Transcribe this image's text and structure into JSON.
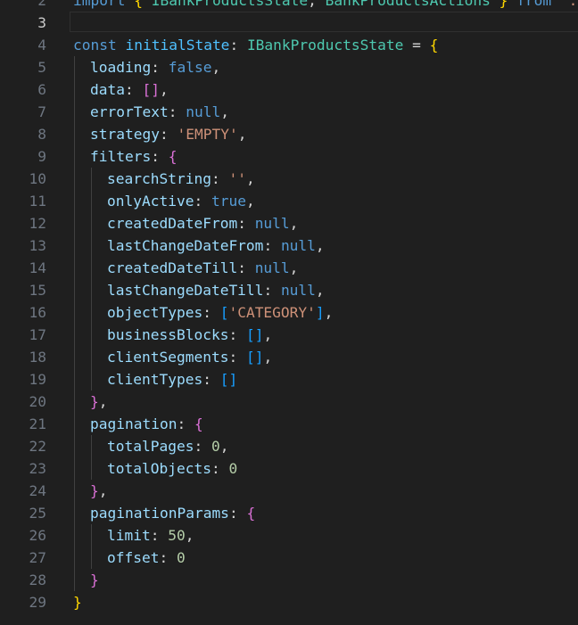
{
  "editor": {
    "language": "typescript",
    "colors": {
      "background": "#1f1f1f",
      "line_number": "#6e7681",
      "line_number_active": "#cccccc",
      "keyword": "#569cd6",
      "type": "#4ec9b0",
      "variable": "#4fc1ff",
      "property": "#9cdcfe",
      "string": "#ce9178",
      "number": "#b5cea8",
      "bracket_level_1": "#ffd700",
      "bracket_level_2": "#da70d6",
      "bracket_level_3": "#179fff"
    },
    "active_line": "3",
    "lines": [
      {
        "n": "2",
        "indent": 0,
        "tokens": [
          [
            "kw",
            "import"
          ],
          [
            "p",
            " "
          ],
          [
            "b1",
            "{"
          ],
          [
            "p",
            " "
          ],
          [
            "type",
            "IBankProductsState"
          ],
          [
            "p",
            ", "
          ],
          [
            "type",
            "BankProductsActions"
          ],
          [
            "p",
            " "
          ],
          [
            "b1",
            "}"
          ],
          [
            "p",
            " "
          ],
          [
            "kw",
            "from"
          ],
          [
            "p",
            " "
          ],
          [
            "str",
            "'./c"
          ]
        ]
      },
      {
        "n": "3",
        "indent": 0,
        "tokens": []
      },
      {
        "n": "4",
        "indent": 0,
        "tokens": [
          [
            "kw",
            "const"
          ],
          [
            "p",
            " "
          ],
          [
            "var",
            "initialState"
          ],
          [
            "p",
            ": "
          ],
          [
            "type",
            "IBankProductsState"
          ],
          [
            "p",
            " = "
          ],
          [
            "b1",
            "{"
          ]
        ]
      },
      {
        "n": "5",
        "indent": 1,
        "tokens": [
          [
            "prop",
            "loading"
          ],
          [
            "p",
            ": "
          ],
          [
            "kw",
            "false"
          ],
          [
            "p",
            ","
          ]
        ]
      },
      {
        "n": "6",
        "indent": 1,
        "tokens": [
          [
            "prop",
            "data"
          ],
          [
            "p",
            ": "
          ],
          [
            "b2",
            "[]"
          ],
          [
            "p",
            ","
          ]
        ]
      },
      {
        "n": "7",
        "indent": 1,
        "tokens": [
          [
            "prop",
            "errorText"
          ],
          [
            "p",
            ": "
          ],
          [
            "kw",
            "null"
          ],
          [
            "p",
            ","
          ]
        ]
      },
      {
        "n": "8",
        "indent": 1,
        "tokens": [
          [
            "prop",
            "strategy"
          ],
          [
            "p",
            ": "
          ],
          [
            "str",
            "'EMPTY'"
          ],
          [
            "p",
            ","
          ]
        ]
      },
      {
        "n": "9",
        "indent": 1,
        "tokens": [
          [
            "prop",
            "filters"
          ],
          [
            "p",
            ": "
          ],
          [
            "b2",
            "{"
          ]
        ]
      },
      {
        "n": "10",
        "indent": 2,
        "tokens": [
          [
            "prop",
            "searchString"
          ],
          [
            "p",
            ": "
          ],
          [
            "str",
            "''"
          ],
          [
            "p",
            ","
          ]
        ]
      },
      {
        "n": "11",
        "indent": 2,
        "tokens": [
          [
            "prop",
            "onlyActive"
          ],
          [
            "p",
            ": "
          ],
          [
            "kw",
            "true"
          ],
          [
            "p",
            ","
          ]
        ]
      },
      {
        "n": "12",
        "indent": 2,
        "tokens": [
          [
            "prop",
            "createdDateFrom"
          ],
          [
            "p",
            ": "
          ],
          [
            "kw",
            "null"
          ],
          [
            "p",
            ","
          ]
        ]
      },
      {
        "n": "13",
        "indent": 2,
        "tokens": [
          [
            "prop",
            "lastChangeDateFrom"
          ],
          [
            "p",
            ": "
          ],
          [
            "kw",
            "null"
          ],
          [
            "p",
            ","
          ]
        ]
      },
      {
        "n": "14",
        "indent": 2,
        "tokens": [
          [
            "prop",
            "createdDateTill"
          ],
          [
            "p",
            ": "
          ],
          [
            "kw",
            "null"
          ],
          [
            "p",
            ","
          ]
        ]
      },
      {
        "n": "15",
        "indent": 2,
        "tokens": [
          [
            "prop",
            "lastChangeDateTill"
          ],
          [
            "p",
            ": "
          ],
          [
            "kw",
            "null"
          ],
          [
            "p",
            ","
          ]
        ]
      },
      {
        "n": "16",
        "indent": 2,
        "tokens": [
          [
            "prop",
            "objectTypes"
          ],
          [
            "p",
            ": "
          ],
          [
            "b3",
            "["
          ],
          [
            "str",
            "'CATEGORY'"
          ],
          [
            "b3",
            "]"
          ],
          [
            "p",
            ","
          ]
        ]
      },
      {
        "n": "17",
        "indent": 2,
        "tokens": [
          [
            "prop",
            "businessBlocks"
          ],
          [
            "p",
            ": "
          ],
          [
            "b3",
            "[]"
          ],
          [
            "p",
            ","
          ]
        ]
      },
      {
        "n": "18",
        "indent": 2,
        "tokens": [
          [
            "prop",
            "clientSegments"
          ],
          [
            "p",
            ": "
          ],
          [
            "b3",
            "[]"
          ],
          [
            "p",
            ","
          ]
        ]
      },
      {
        "n": "19",
        "indent": 2,
        "tokens": [
          [
            "prop",
            "clientTypes"
          ],
          [
            "p",
            ": "
          ],
          [
            "b3",
            "[]"
          ]
        ]
      },
      {
        "n": "20",
        "indent": 1,
        "tokens": [
          [
            "b2",
            "}"
          ],
          [
            "p",
            ","
          ]
        ]
      },
      {
        "n": "21",
        "indent": 1,
        "tokens": [
          [
            "prop",
            "pagination"
          ],
          [
            "p",
            ": "
          ],
          [
            "b2",
            "{"
          ]
        ]
      },
      {
        "n": "22",
        "indent": 2,
        "tokens": [
          [
            "prop",
            "totalPages"
          ],
          [
            "p",
            ": "
          ],
          [
            "num",
            "0"
          ],
          [
            "p",
            ","
          ]
        ]
      },
      {
        "n": "23",
        "indent": 2,
        "tokens": [
          [
            "prop",
            "totalObjects"
          ],
          [
            "p",
            ": "
          ],
          [
            "num",
            "0"
          ]
        ]
      },
      {
        "n": "24",
        "indent": 1,
        "tokens": [
          [
            "b2",
            "}"
          ],
          [
            "p",
            ","
          ]
        ]
      },
      {
        "n": "25",
        "indent": 1,
        "tokens": [
          [
            "prop",
            "paginationParams"
          ],
          [
            "p",
            ": "
          ],
          [
            "b2",
            "{"
          ]
        ]
      },
      {
        "n": "26",
        "indent": 2,
        "tokens": [
          [
            "prop",
            "limit"
          ],
          [
            "p",
            ": "
          ],
          [
            "num",
            "50"
          ],
          [
            "p",
            ","
          ]
        ]
      },
      {
        "n": "27",
        "indent": 2,
        "tokens": [
          [
            "prop",
            "offset"
          ],
          [
            "p",
            ": "
          ],
          [
            "num",
            "0"
          ]
        ]
      },
      {
        "n": "28",
        "indent": 1,
        "tokens": [
          [
            "b2",
            "}"
          ]
        ]
      },
      {
        "n": "29",
        "indent": 0,
        "tokens": [
          [
            "b1",
            "}"
          ]
        ]
      }
    ]
  }
}
